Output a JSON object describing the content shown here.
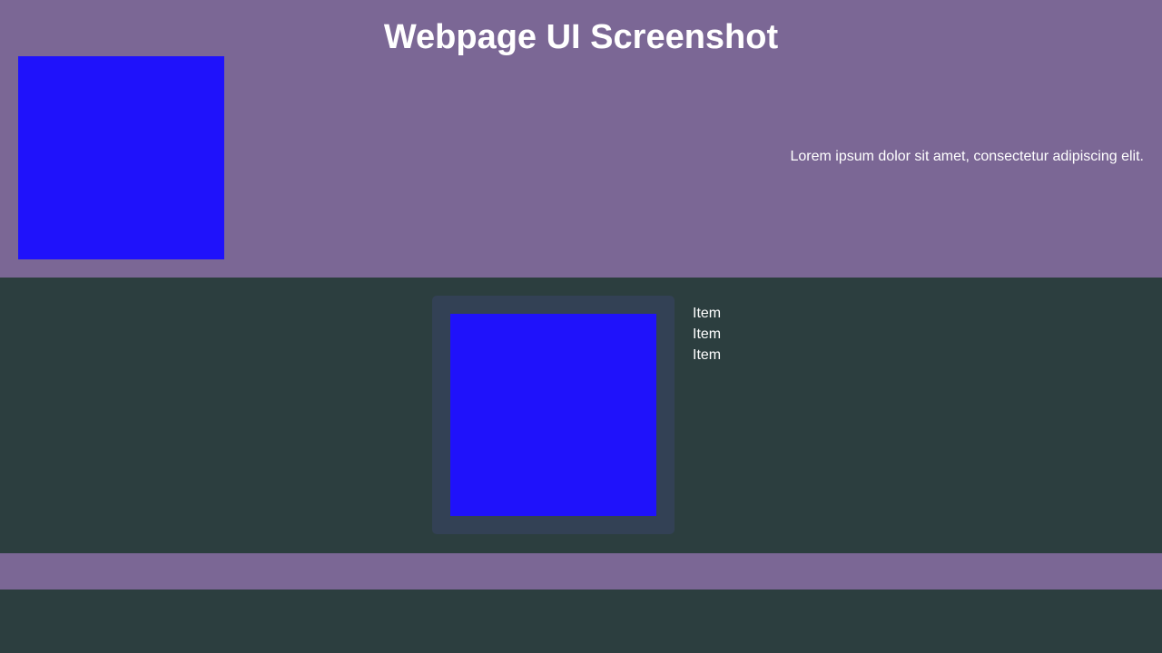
{
  "header": {
    "title": "Webpage UI Screenshot",
    "description": "Lorem ipsum dolor sit amet, consectetur adipiscing elit."
  },
  "main": {
    "list_items": [
      "Item",
      "Item",
      "Item"
    ]
  },
  "colors": {
    "accent": "#7b6795",
    "background": "#2c3e3f",
    "card": "#334155",
    "image_placeholder": "#1f12fb"
  }
}
